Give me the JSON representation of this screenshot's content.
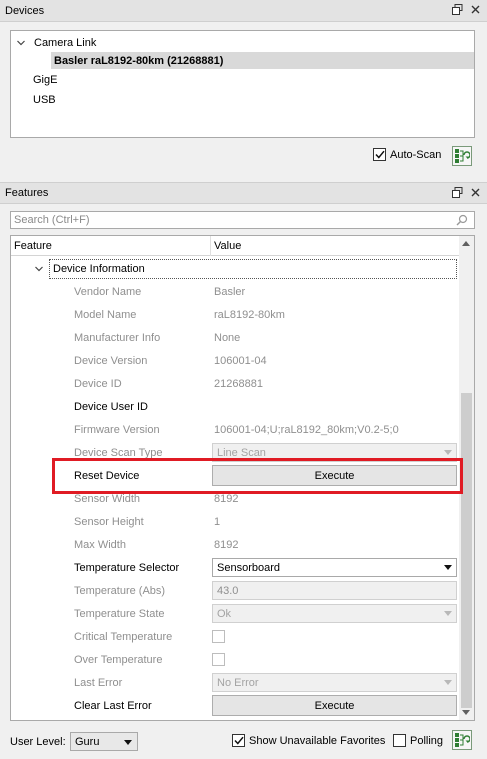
{
  "devices_panel": {
    "title": "Devices",
    "tree": [
      {
        "label": "Camera Link",
        "expanded": true
      },
      {
        "label": "Basler raL8192-80km (21268881)",
        "selected": true
      },
      {
        "label": "GigE"
      },
      {
        "label": "USB"
      }
    ],
    "auto_scan_label": "Auto-Scan",
    "auto_scan_checked": true
  },
  "features_panel": {
    "title": "Features",
    "search_placeholder": "Search (Ctrl+F)",
    "columns": [
      "Feature",
      "Value"
    ],
    "category": "Device Information",
    "rows": [
      {
        "name": "Vendor Name",
        "value": "Basler",
        "kind": "text",
        "enabled": false
      },
      {
        "name": "Model Name",
        "value": "raL8192-80km",
        "kind": "text",
        "enabled": false
      },
      {
        "name": "Manufacturer Info",
        "value": "None",
        "kind": "text",
        "enabled": false
      },
      {
        "name": "Device Version",
        "value": "106001-04",
        "kind": "text",
        "enabled": false
      },
      {
        "name": "Device ID",
        "value": "21268881",
        "kind": "text",
        "enabled": false
      },
      {
        "name": "Device User ID",
        "value": "",
        "kind": "text",
        "enabled": true
      },
      {
        "name": "Firmware Version",
        "value": "106001-04;U;raL8192_80km;V0.2-5;0",
        "kind": "text",
        "enabled": false
      },
      {
        "name": "Device Scan Type",
        "value": "Line Scan",
        "kind": "combo",
        "enabled": false
      },
      {
        "name": "Reset Device",
        "value": "Execute",
        "kind": "button",
        "enabled": true
      },
      {
        "name": "Sensor Width",
        "value": "8192",
        "kind": "text",
        "enabled": false
      },
      {
        "name": "Sensor Height",
        "value": "1",
        "kind": "text",
        "enabled": false
      },
      {
        "name": "Max Width",
        "value": "8192",
        "kind": "text",
        "enabled": false
      },
      {
        "name": "Temperature Selector",
        "value": "Sensorboard",
        "kind": "combo",
        "enabled": true
      },
      {
        "name": "Temperature (Abs)",
        "value": "43.0",
        "kind": "textbox",
        "enabled": false
      },
      {
        "name": "Temperature State",
        "value": "Ok",
        "kind": "combo",
        "enabled": false
      },
      {
        "name": "Critical Temperature",
        "value": "",
        "kind": "checkbox",
        "enabled": false
      },
      {
        "name": "Over Temperature",
        "value": "",
        "kind": "checkbox",
        "enabled": false
      },
      {
        "name": "Last Error",
        "value": "No Error",
        "kind": "combo",
        "enabled": false
      },
      {
        "name": "Clear Last Error",
        "value": "Execute",
        "kind": "button",
        "enabled": true
      }
    ]
  },
  "bottom_bar": {
    "user_level_label": "User Level:",
    "user_level_value": "Guru",
    "show_unavailable_label": "Show Unavailable Favorites",
    "show_unavailable_checked": true,
    "polling_label": "Polling",
    "polling_checked": false
  },
  "colors": {
    "highlight": "#e01b24",
    "selection": "#d9d9d9",
    "disabled_text": "#8f8f8f"
  }
}
